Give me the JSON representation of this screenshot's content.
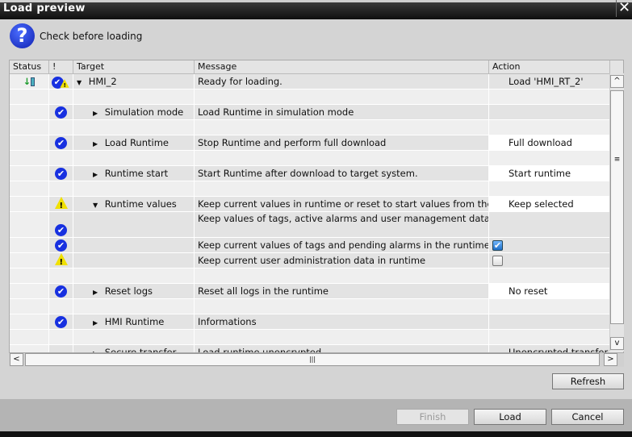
{
  "window": {
    "title": "Load preview",
    "close_icon": "close-icon"
  },
  "heading": {
    "icon": "question-icon",
    "icon_glyph": "?",
    "text": "Check before loading"
  },
  "table": {
    "headers": {
      "status": "Status",
      "alert": "!",
      "target": "Target",
      "message": "Message",
      "action": "Action"
    },
    "rows": [
      {
        "kind": "content",
        "status": "download-device-icon",
        "alert": "ok-warn",
        "expander": "down",
        "indent": 0,
        "target": "HMI_2",
        "message": "Ready for loading.",
        "action": "Load 'HMI_RT_2'",
        "action_style": "content"
      },
      {
        "kind": "blank"
      },
      {
        "kind": "content",
        "alert": "ok",
        "expander": "right",
        "indent": 1,
        "target": "Simulation mode",
        "message": "Load Runtime in simulation mode",
        "action": "",
        "action_style": "content"
      },
      {
        "kind": "blank"
      },
      {
        "kind": "content",
        "alert": "ok",
        "expander": "right",
        "indent": 1,
        "target": "Load Runtime",
        "message": "Stop Runtime and perform full download",
        "action": "Full download",
        "action_style": "white"
      },
      {
        "kind": "blank"
      },
      {
        "kind": "content",
        "alert": "ok",
        "expander": "right",
        "indent": 1,
        "target": "Runtime start",
        "message": "Start Runtime after download to target system.",
        "action": "Start runtime",
        "action_style": "white"
      },
      {
        "kind": "blank"
      },
      {
        "kind": "content",
        "alert": "warn",
        "expander": "down",
        "indent": 1,
        "target": "Runtime values",
        "message": "Keep current values in runtime or reset to start values from the en",
        "action": "Keep selected",
        "action_style": "white"
      },
      {
        "kind": "sub",
        "tall": true,
        "alert": "ok",
        "message": "Keep values of tags, active alarms and user management data."
      },
      {
        "kind": "sub",
        "alert": "ok",
        "message": "Keep current values of tags and pending alarms in the runtime",
        "checkbox": true
      },
      {
        "kind": "sub",
        "alert": "warn",
        "message": "Keep current user administration data in runtime",
        "checkbox": false
      },
      {
        "kind": "blank"
      },
      {
        "kind": "content",
        "alert": "ok",
        "expander": "right",
        "indent": 1,
        "target": "Reset logs",
        "message": "Reset all logs in the runtime",
        "action": "No reset",
        "action_style": "white"
      },
      {
        "kind": "blank"
      },
      {
        "kind": "content",
        "alert": "ok",
        "expander": "right",
        "indent": 1,
        "target": "HMI Runtime",
        "message": "Informations",
        "action": "",
        "action_style": "content"
      },
      {
        "kind": "blank"
      },
      {
        "kind": "content",
        "expander": "right",
        "indent": 1,
        "target": "Secure transfer",
        "message": "Load runtime unencrypted",
        "action": "Unencrypted transfer",
        "action_style": "content"
      }
    ]
  },
  "buttons": {
    "refresh": "Refresh",
    "finish": "Finish",
    "load": "Load",
    "cancel": "Cancel"
  },
  "scroll": {
    "up": "^",
    "down": "v",
    "left": "<",
    "right": ">",
    "thumb": "|||",
    "grip": "≡"
  }
}
